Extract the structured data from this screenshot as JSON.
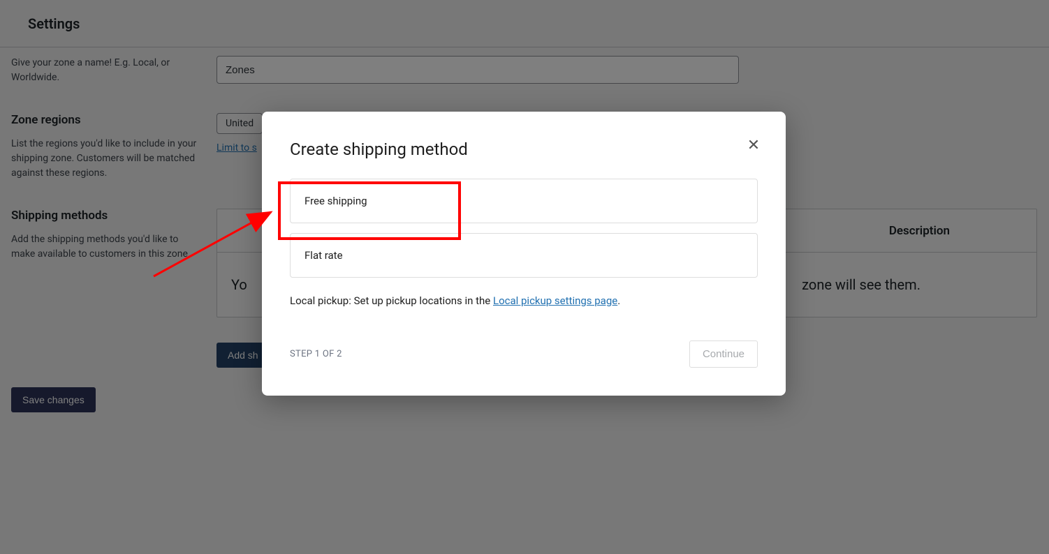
{
  "header": {
    "title": "Settings"
  },
  "zone_name": {
    "desc": "Give your zone a name! E.g. Local, or Worldwide.",
    "value": "Zones"
  },
  "zone_regions": {
    "title": "Zone regions",
    "desc": "List the regions you'd like to include in your shipping zone. Customers will be matched against these regions.",
    "tag_visible": "United",
    "limit_link_visible": "Limit to s"
  },
  "shipping_methods": {
    "title": "Shipping methods",
    "desc": "Add the shipping methods you'd like to make available to customers in this zone.",
    "col_desc": "Description",
    "empty_left": "Yo",
    "empty_right": "zone will see them.",
    "add_button": "Add sh"
  },
  "save_button": "Save changes",
  "modal": {
    "title": "Create shipping method",
    "options": {
      "free": "Free shipping",
      "flat": "Flat rate"
    },
    "local_pickup_prefix": "Local pickup: Set up pickup locations in the ",
    "local_pickup_link": "Local pickup settings page",
    "step": "STEP 1 OF 2",
    "continue": "Continue"
  }
}
